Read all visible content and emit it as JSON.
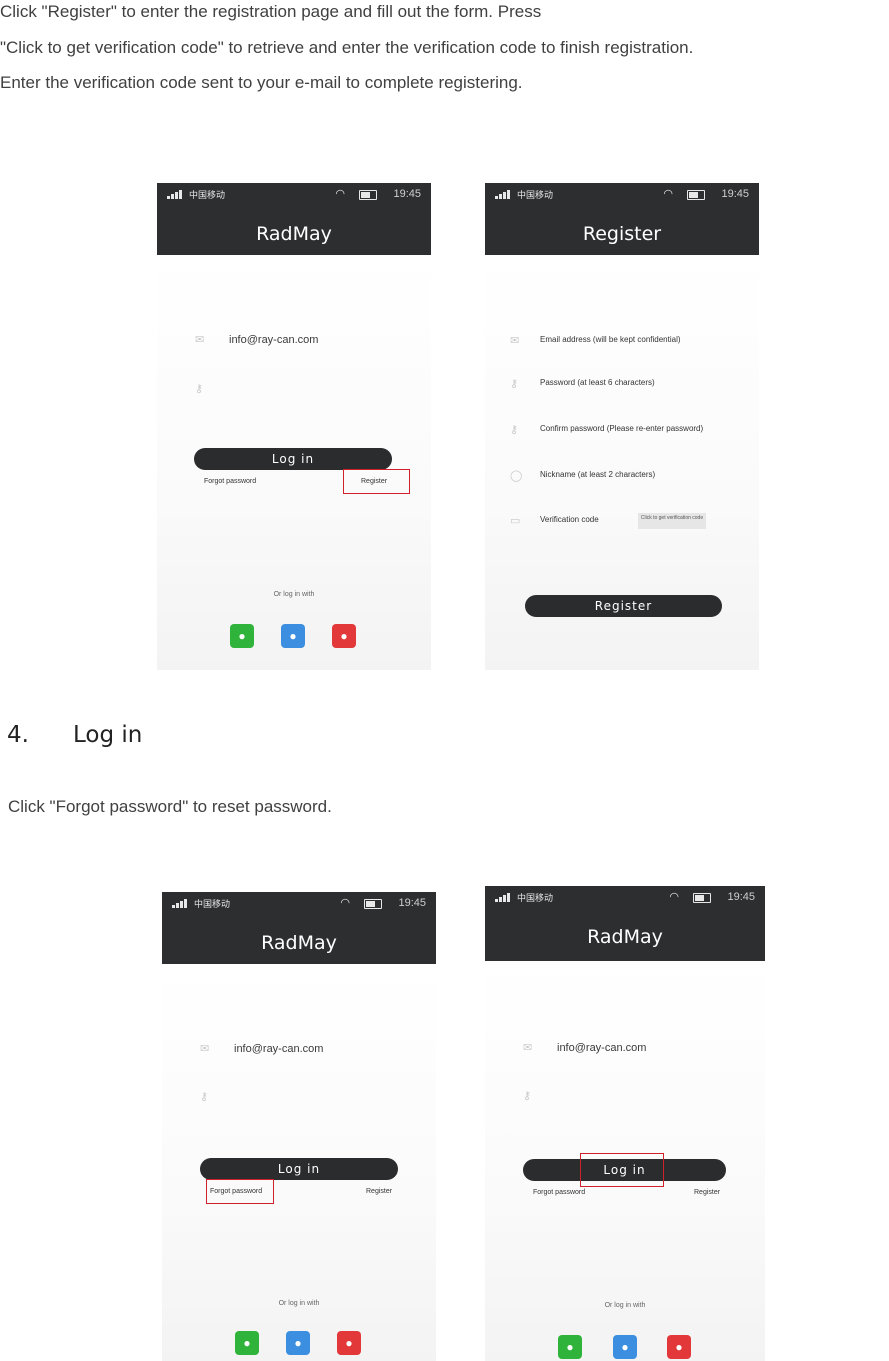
{
  "intro": {
    "line1": "Click \"Register\" to enter the registration page and fill out the form. Press",
    "line2": "\"Click to get verification code\" to retrieve and enter the verification code to finish registration.",
    "line3": "Enter the verification code sent to your e-mail to complete registering."
  },
  "section": {
    "number": "4.",
    "title": "Log in"
  },
  "section_text": "Click \"Forgot password\" to reset password.",
  "status_bar": {
    "carrier": "中国移动",
    "time": "19:45",
    "wifi_icon": "wifi-icon",
    "battery_icon": "battery-icon"
  },
  "login_screen": {
    "title": "RadMay",
    "email_value": "info@ray-can.com",
    "login_label": "Log  in",
    "forgot_label": "Forgot password",
    "register_label": "Register",
    "or_log_in_with": "Or log in with",
    "social": [
      "wechat-icon",
      "qq-icon",
      "weibo-icon"
    ]
  },
  "register_screen": {
    "title": "Register",
    "fields": [
      "Email address (will be kept confidential)",
      "Password (at least 6 characters)",
      "Confirm password (Please re-enter password)",
      "Nickname (at least 2 characters)",
      "Verification code"
    ],
    "verify_button": "Click to get verification code",
    "register_button": "Register"
  },
  "colors": {
    "topbar": "#2d2e30",
    "highlight": "#d0212b",
    "button": "#2b2c2e"
  }
}
